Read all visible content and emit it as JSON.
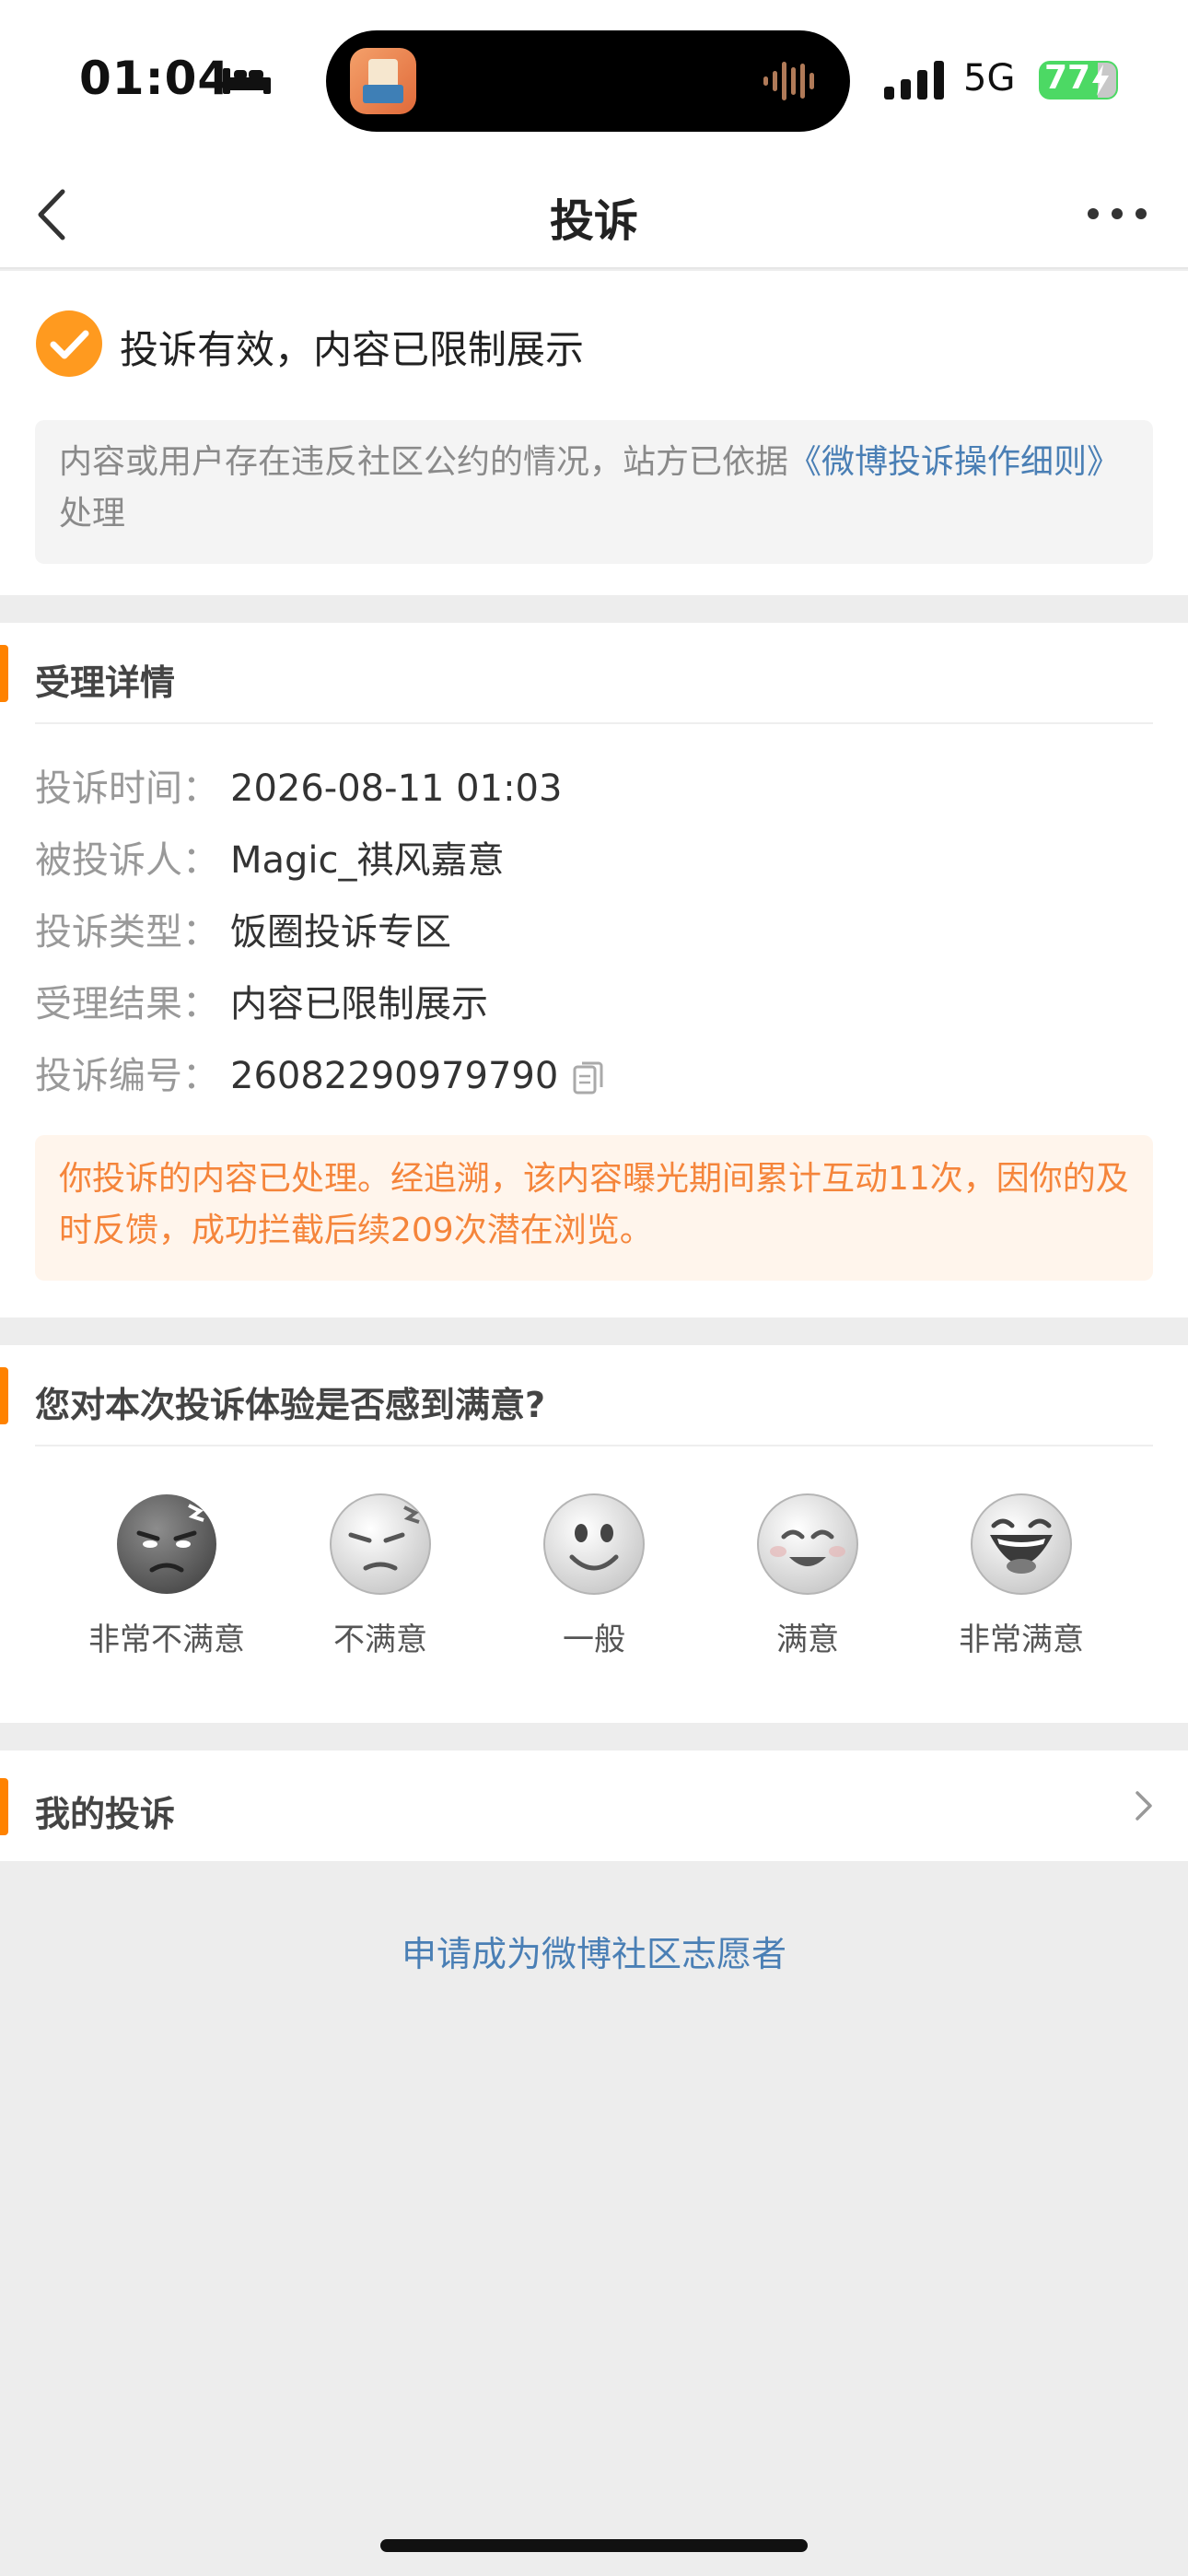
{
  "status_bar": {
    "time": "01:04",
    "network": "5G",
    "battery": "77"
  },
  "nav": {
    "title": "投诉"
  },
  "result": {
    "title": "投诉有效，内容已限制展示",
    "rule_text_prefix": "内容或用户存在违反社区公约的情况，站方已依据",
    "rule_link": "《微博投诉操作细则》",
    "rule_text_suffix": "处理"
  },
  "details": {
    "section_title": "受理详情",
    "rows": [
      {
        "label": "投诉时间：",
        "value": "2026-08-11 01:03"
      },
      {
        "label": "被投诉人：",
        "value": "Magic_祺风嘉意"
      },
      {
        "label": "投诉类型：",
        "value": "饭圈投诉专区"
      },
      {
        "label": "受理结果：",
        "value": "内容已限制展示"
      },
      {
        "label": "投诉编号：",
        "value": "26082290979790"
      }
    ],
    "notice": "你投诉的内容已处理。经追溯，该内容曝光期间累计互动11次，因你的及时反馈，成功拦截后续209次潜在浏览。"
  },
  "satisfaction": {
    "question": "您对本次投诉体验是否感到满意?",
    "options": [
      {
        "label": "非常不满意",
        "icon": "very-unsatisfied-emoji"
      },
      {
        "label": "不满意",
        "icon": "unsatisfied-emoji"
      },
      {
        "label": "一般",
        "icon": "neutral-emoji"
      },
      {
        "label": "满意",
        "icon": "satisfied-emoji"
      },
      {
        "label": "非常满意",
        "icon": "very-satisfied-emoji"
      }
    ]
  },
  "my_complaints": {
    "label": "我的投诉"
  },
  "volunteer": {
    "label": "申请成为微博社区志愿者"
  },
  "colors": {
    "accent": "#ff8200",
    "link": "#4a7fb5",
    "notice_text": "#f5853b",
    "notice_bg": "#fff5ec"
  }
}
